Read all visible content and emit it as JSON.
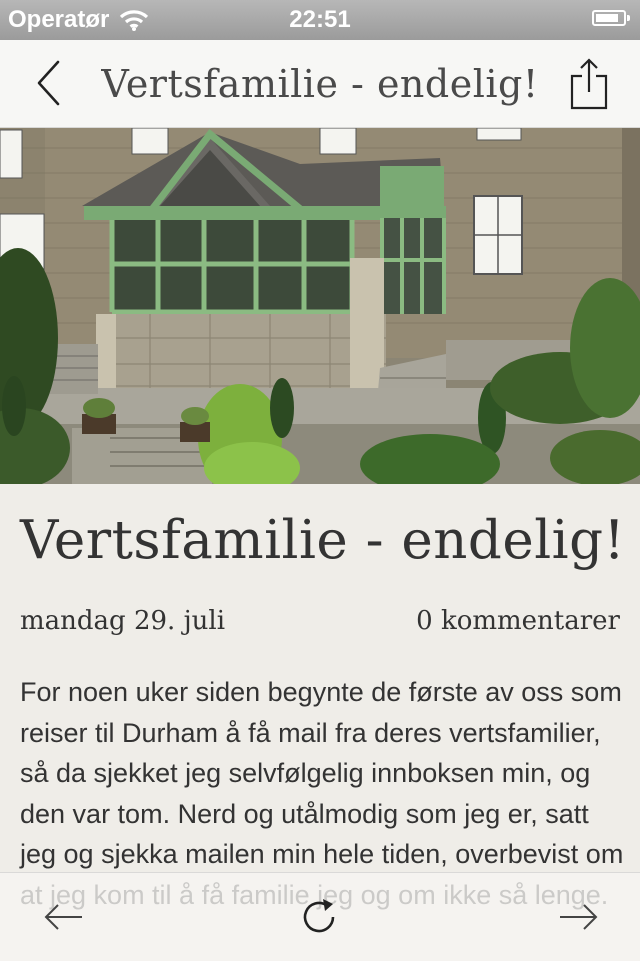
{
  "status_bar": {
    "carrier": "Operatør",
    "time": "22:51",
    "wifi_icon": "wifi-icon",
    "battery_icon": "battery-icon"
  },
  "nav": {
    "back_icon": "chevron-left-icon",
    "title": "Vertsfamilie - endelig!",
    "share_icon": "share-icon"
  },
  "hero": {
    "description_icon": "house-photo"
  },
  "article": {
    "title": "Vertsfamilie - endelig!",
    "date": "mandag 29. juli",
    "comments": "0 kommentarer",
    "body": "For noen uker siden begynte de første av oss som reiser til Durham å få mail fra deres vertsfamilier, så da sjekket jeg selvfølgelig innboksen min, og den var tom. Nerd og utålmodig som jeg er, satt jeg og sjekka mailen min hele tiden, overbevist om at jeg kom til å få familie jeg og om ikke så lenge."
  },
  "toolbar": {
    "prev_icon": "arrow-left-icon",
    "reload_icon": "refresh-icon",
    "next_icon": "arrow-right-icon"
  },
  "colors": {
    "status_bar": "#a8a8a8",
    "nav_bar": "#f7f7f5",
    "background": "#efede8",
    "text": "#333333"
  }
}
